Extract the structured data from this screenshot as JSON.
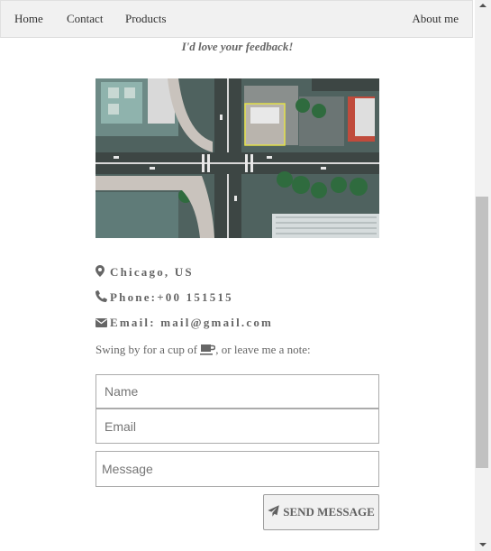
{
  "nav": {
    "home": "Home",
    "contact": "Contact",
    "products": "Products",
    "about": "About me"
  },
  "tagline": "I'd love your feedback!",
  "contact_info": {
    "city": "Chicago, US",
    "phone": "Phone:+00 151515",
    "email": "Email: mail@gmail.com",
    "icons": [
      "map-marker-icon",
      "phone-icon",
      "envelope-icon"
    ]
  },
  "note": {
    "before": "Swing by for a cup of ",
    "after": ", or leave me a note:",
    "icon": "coffee-icon"
  },
  "form": {
    "name_placeholder": "Name",
    "email_placeholder": "Email",
    "message_placeholder": "Message",
    "send_label": "SEND MESSAGE",
    "send_icon": "paper-plane-icon"
  },
  "colors": {
    "nav_bg": "#f1f1f1",
    "text": "#666666",
    "button_bg": "#f1f1f1"
  }
}
